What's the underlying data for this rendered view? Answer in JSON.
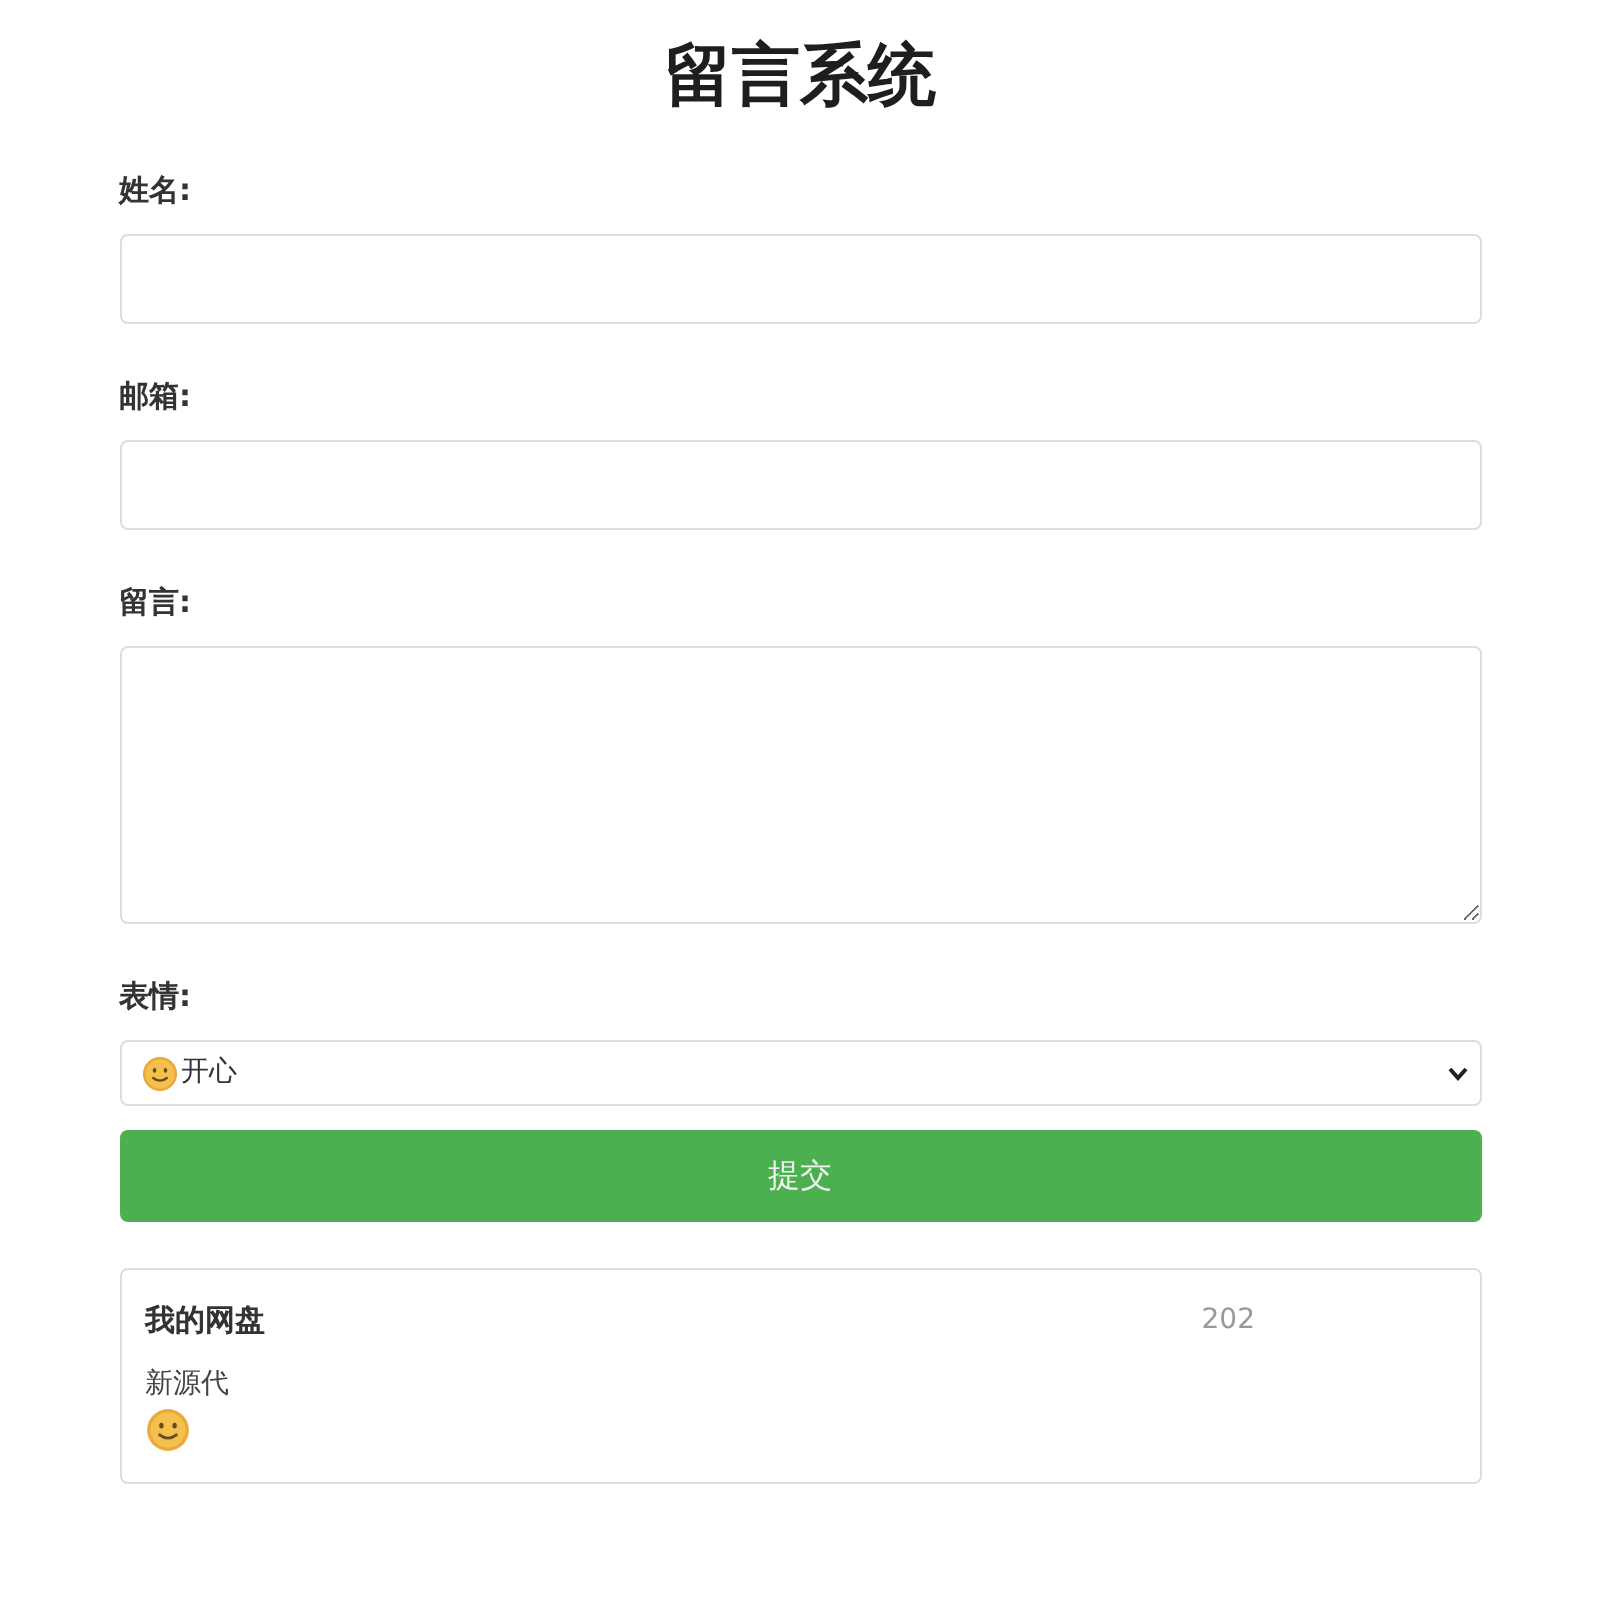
{
  "title": "留言系统",
  "form": {
    "fields": [
      {
        "kind": "input",
        "label": "姓名:"
      },
      {
        "kind": "input",
        "label": "邮箱:"
      },
      {
        "kind": "textarea",
        "label": "留言:"
      },
      {
        "kind": "select",
        "label": "表情:",
        "value": "开心"
      }
    ],
    "submit": "提交"
  },
  "messages": [
    {
      "name": "我的网盘",
      "time": "202",
      "text": "新源代"
    }
  ]
}
